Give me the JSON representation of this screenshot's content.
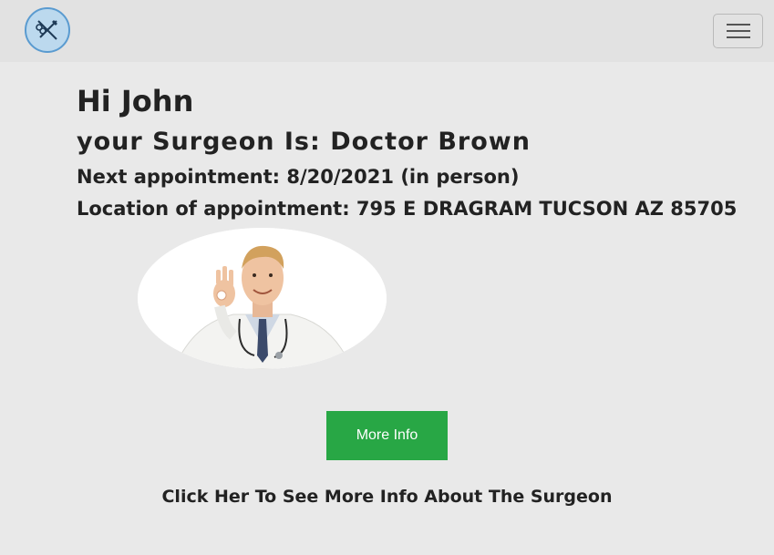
{
  "navbar": {
    "logo_icon": "surgical-tools-icon",
    "toggle_icon": "hamburger-menu-icon"
  },
  "main": {
    "greeting": "Hi John",
    "surgeon_line": "your Surgeon Is: Doctor Brown",
    "appointment_line": "Next appointment: 8/20/2021 (in person)",
    "location_line": "Location of appointment: 795 E DRAGRAM TUCSON AZ 85705",
    "more_info_button": "More Info",
    "more_info_link": "Click Her To See More Info About The Surgeon"
  },
  "colors": {
    "page_bg": "#e9e9e9",
    "navbar_bg": "#e2e2e2",
    "button_green": "#28a745",
    "logo_bg": "#bcd9ee"
  }
}
